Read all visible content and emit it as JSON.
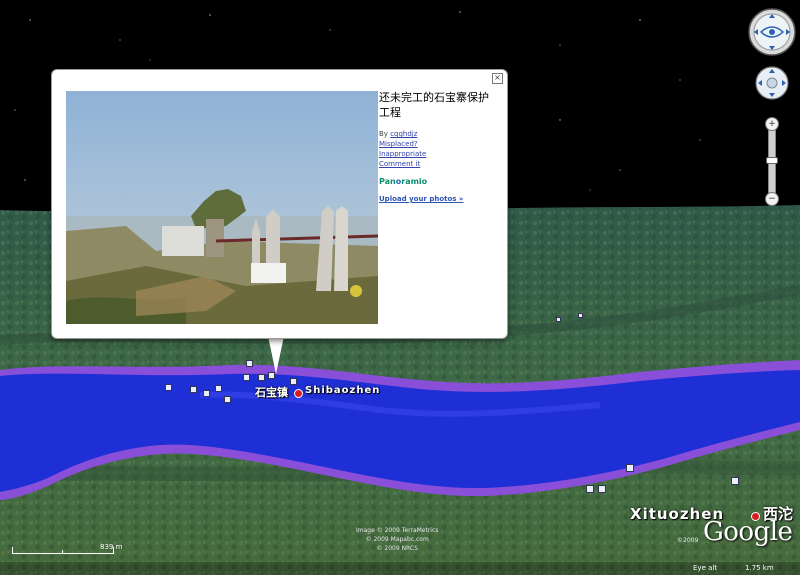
{
  "popup": {
    "close_glyph": "×",
    "title": "还未完工的石宝寨保护工程",
    "by_prefix": "By",
    "author": "cqghdjz",
    "misplaced": "Misplaced?",
    "inappropriate": "Inappropriate",
    "comment": "Comment it",
    "panoramio_pre": "Pan",
    "panoramio_o": "o",
    "panoramio_post": "ramio",
    "upload": "Upload your photos »"
  },
  "places": {
    "shibaozhen_cn": "石宝镇",
    "shibaozhen_en": "Shibaozhen",
    "xituozhen_en": "Xituozhen",
    "xituozhen_cn": "西沱"
  },
  "credits": {
    "line1": "Image © 2009 TerraMetrics",
    "line2": "© 2009 Mapabc.com",
    "line3": "© 2009 NRCS"
  },
  "logo": {
    "text": "Google",
    "year": "©2009"
  },
  "scale": {
    "label": "839 m"
  },
  "eye_alt": {
    "label": "Eye alt",
    "value": "1.75 km"
  },
  "controls": {
    "zoom_in": "+",
    "zoom_out": "−"
  },
  "colors": {
    "water": "#1f2fd6",
    "water_edge": "#8a4fd8",
    "link": "#3344aa"
  }
}
